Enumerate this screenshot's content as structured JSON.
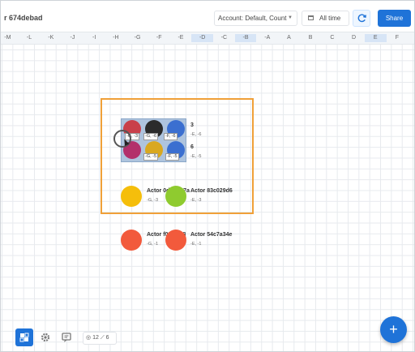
{
  "header": {
    "title": "r 674debad",
    "account_select": "Account: Default, Count",
    "time_button": "All time",
    "share_button": "Share"
  },
  "columns": [
    "-M",
    "-L",
    "-K",
    "-J",
    "-I",
    "-H",
    "-G",
    "-F",
    "-E",
    "-D",
    "-C",
    "-B",
    "-A",
    "A",
    "B",
    "C",
    "D",
    "E",
    "F"
  ],
  "highlighted_columns": [
    "-D",
    "-B",
    "E"
  ],
  "cluster": {
    "tags": [
      "-G, -3",
      "-G, -6",
      "-F, -6",
      "-G, -5",
      "-F, -5"
    ],
    "groups": [
      {
        "count": "3",
        "coord": "-E, -6"
      },
      {
        "count": "6",
        "coord": "-E, -5"
      }
    ]
  },
  "actors": [
    {
      "label": "Actor 0ddbd87a",
      "coord": "-G, -3",
      "color": "#f5be0b"
    },
    {
      "label": "Actor 83c029d6",
      "coord": "-E, -3",
      "color": "#8fcb2f"
    },
    {
      "label": "Actor f034fc08",
      "coord": "-G, -1",
      "color": "#f25a3c"
    },
    {
      "label": "Actor 54c7a34e",
      "coord": "-E, -1",
      "color": "#f25a3c"
    }
  ],
  "cluster_colors": {
    "red": "#c9404a",
    "black": "#2b2b2b",
    "blue": "#3b6fd0",
    "magenta": "#b3306b",
    "yellow": "#d9a820"
  },
  "toolbar": {
    "actors_count": "12",
    "links_count": "6"
  },
  "fab_label": "+"
}
